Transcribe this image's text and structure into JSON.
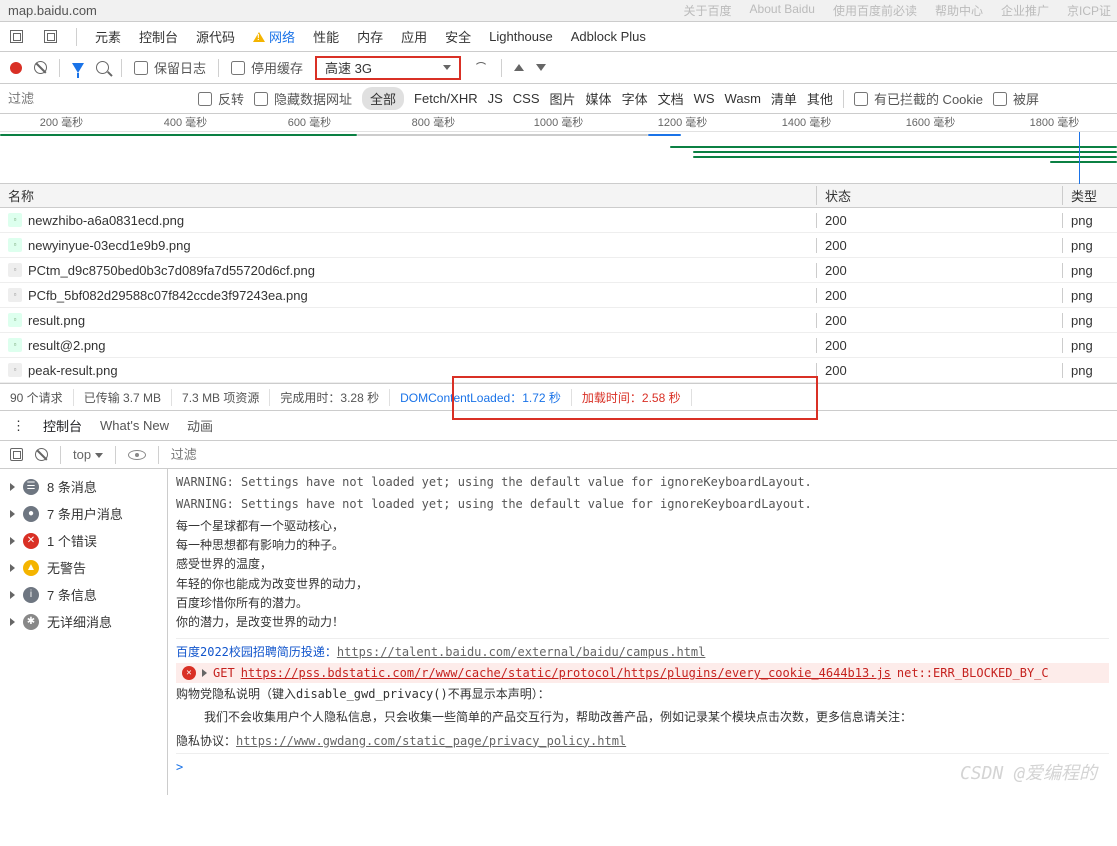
{
  "url": "map.baidu.com",
  "faded_top_links": [
    "关于百度",
    "About Baidu",
    "使用百度前必读",
    "帮助中心",
    "企业推广",
    "京ICP证"
  ],
  "tabs": [
    "元素",
    "控制台",
    "源代码",
    "网络",
    "性能",
    "内存",
    "应用",
    "安全",
    "Lighthouse",
    "Adblock Plus"
  ],
  "active_tab_index": 3,
  "toolbar": {
    "preserve_log": "保留日志",
    "disable_cache": "停用缓存",
    "throttling_selected": "高速 3G"
  },
  "filter": {
    "placeholder": "过滤",
    "invert": "反转",
    "hide_data_urls": "隐藏数据网址",
    "all": "全部",
    "types": [
      "Fetch/XHR",
      "JS",
      "CSS",
      "图片",
      "媒体",
      "字体",
      "文档",
      "WS",
      "Wasm",
      "清单",
      "其他"
    ],
    "blocked_cookies": "有已拦截的 Cookie",
    "blocked_requests": "被屏"
  },
  "timeline_labels": [
    "200 毫秒",
    "400 毫秒",
    "600 毫秒",
    "800 毫秒",
    "1000 毫秒",
    "1200 毫秒",
    "1400 毫秒",
    "1600 毫秒",
    "1800 毫秒"
  ],
  "table": {
    "headers": {
      "name": "名称",
      "status": "状态",
      "type": "类型"
    },
    "rows": [
      {
        "name": "newzhibo-a6a0831ecd.png",
        "status": "200",
        "type": "png",
        "icon": "pic"
      },
      {
        "name": "newyinyue-03ecd1e9b9.png",
        "status": "200",
        "type": "png",
        "icon": "pic"
      },
      {
        "name": "PCtm_d9c8750bed0b3c7d089fa7d55720d6cf.png",
        "status": "200",
        "type": "png",
        "icon": "doc"
      },
      {
        "name": "PCfb_5bf082d29588c07f842ccde3f97243ea.png",
        "status": "200",
        "type": "png",
        "icon": "doc"
      },
      {
        "name": "result.png",
        "status": "200",
        "type": "png",
        "icon": "pic"
      },
      {
        "name": "result@2.png",
        "status": "200",
        "type": "png",
        "icon": "pic"
      },
      {
        "name": "peak-result.png",
        "status": "200",
        "type": "png",
        "icon": "doc"
      }
    ]
  },
  "summary": {
    "requests": "90 个请求",
    "transferred": "已传输 3.7 MB",
    "resources": "7.3 MB 项资源",
    "finish": "完成用时：3.28 秒",
    "dcl_label": "DOMContentLoaded：",
    "dcl_value": "1.72 秒",
    "load_label": "加载时间：",
    "load_value": "2.58 秒"
  },
  "drawer_tabs": [
    "控制台",
    "What's New",
    "动画"
  ],
  "console_toolbar": {
    "context": "top",
    "filter_placeholder": "过滤"
  },
  "sidebar_items": [
    {
      "label": "8 条消息",
      "icon": "list"
    },
    {
      "label": "7 条用户消息",
      "icon": "user"
    },
    {
      "label": "1 个错误",
      "icon": "error"
    },
    {
      "label": "无警告",
      "icon": "warn"
    },
    {
      "label": "7 条信息",
      "icon": "info"
    },
    {
      "label": "无详细消息",
      "icon": "gear"
    }
  ],
  "console": {
    "warn1": "WARNING: Settings have not loaded yet; using the default value for ignoreKeyboardLayout.",
    "warn2": "WARNING: Settings have not loaded yet; using the default value for ignoreKeyboardLayout.",
    "body": "每一个星球都有一个驱动核心，\n每一种思想都有影响力的种子。\n感受世界的温度，\n年轻的你也能成为改变世界的动力，\n百度珍惜你所有的潜力。\n你的潜力，是改变世界的动力！",
    "link_label": "百度2022校园招聘简历投递：",
    "link_url": "https://talent.baidu.com/external/baidu/campus.html",
    "err_method": "GET",
    "err_url": "https://pss.bdstatic.com/r/www/cache/static/protocol/https/plugins/every_cookie_4644b13.js",
    "err_code": "net::ERR_BLOCKED_BY_C",
    "privacy_label": "购物党隐私说明（键入disable_gwd_privacy()不再显示本声明）：",
    "privacy_body": "我们不会收集用户个人隐私信息，只会收集一些简单的产品交互行为，帮助改善产品，例如记录某个模块点击次数，更多信息请关注：",
    "privacy_link_label": "隐私协议：",
    "privacy_link_url": "https://www.gwdang.com/static_page/privacy_policy.html",
    "prompt": ">"
  },
  "watermark": "CSDN @爱编程的"
}
